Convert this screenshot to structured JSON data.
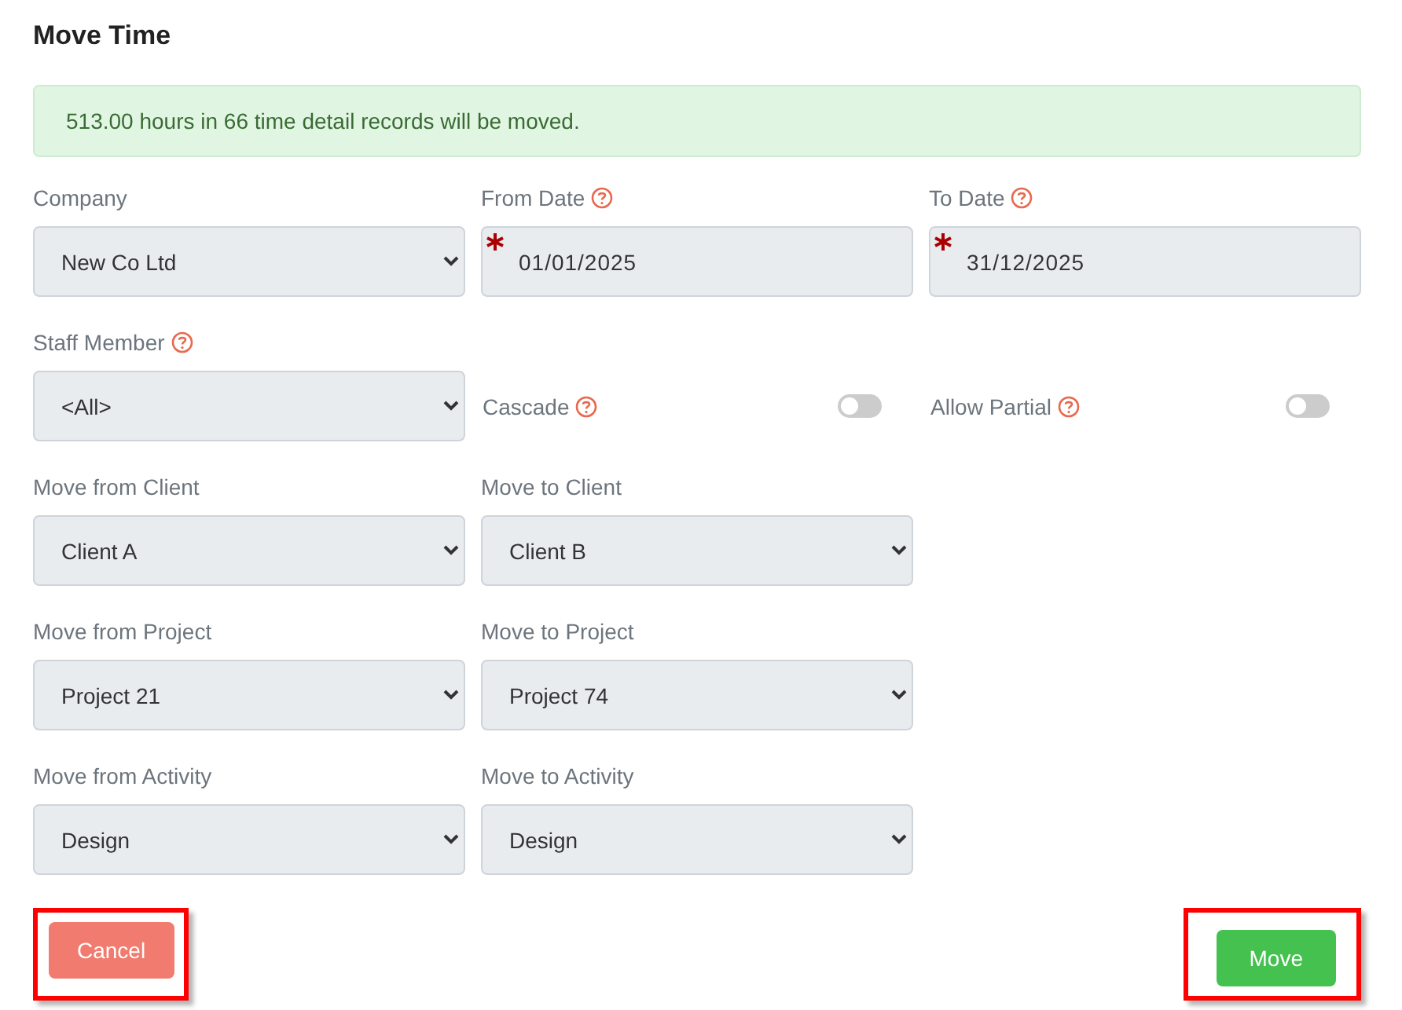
{
  "title": "Move Time",
  "alert": {
    "text": "513.00 hours in 66 time detail records will be moved."
  },
  "rows": [
    [
      {
        "kind": "select",
        "label": "Company",
        "help": false,
        "value": "New Co Ltd"
      },
      {
        "kind": "date",
        "label": "From Date",
        "help": true,
        "required": true,
        "value": "01/01/2025"
      },
      {
        "kind": "date",
        "label": "To Date",
        "help": true,
        "required": true,
        "value": "31/12/2025"
      }
    ],
    [
      {
        "kind": "select",
        "label": "Staff Member",
        "help": true,
        "value": "<All>"
      },
      {
        "kind": "toggle",
        "label": "Cascade",
        "help": true,
        "on": false
      },
      {
        "kind": "toggle",
        "label": "Allow Partial",
        "help": true,
        "on": false
      }
    ],
    [
      {
        "kind": "select",
        "label": "Move from Client",
        "help": false,
        "value": "Client A"
      },
      {
        "kind": "select",
        "label": "Move to Client",
        "help": false,
        "value": "Client B"
      }
    ],
    [
      {
        "kind": "select",
        "label": "Move from Project",
        "help": false,
        "value": "Project 21"
      },
      {
        "kind": "select",
        "label": "Move to Project",
        "help": false,
        "value": "Project 74"
      }
    ],
    [
      {
        "kind": "select",
        "label": "Move from Activity",
        "help": false,
        "value": "Design"
      },
      {
        "kind": "select",
        "label": "Move to Activity",
        "help": false,
        "value": "Design"
      }
    ]
  ],
  "buttons": [
    {
      "kind": "cancel",
      "label": "Cancel",
      "highlighted": true
    },
    {
      "kind": "primary",
      "label": "Move",
      "highlighted": true
    }
  ]
}
